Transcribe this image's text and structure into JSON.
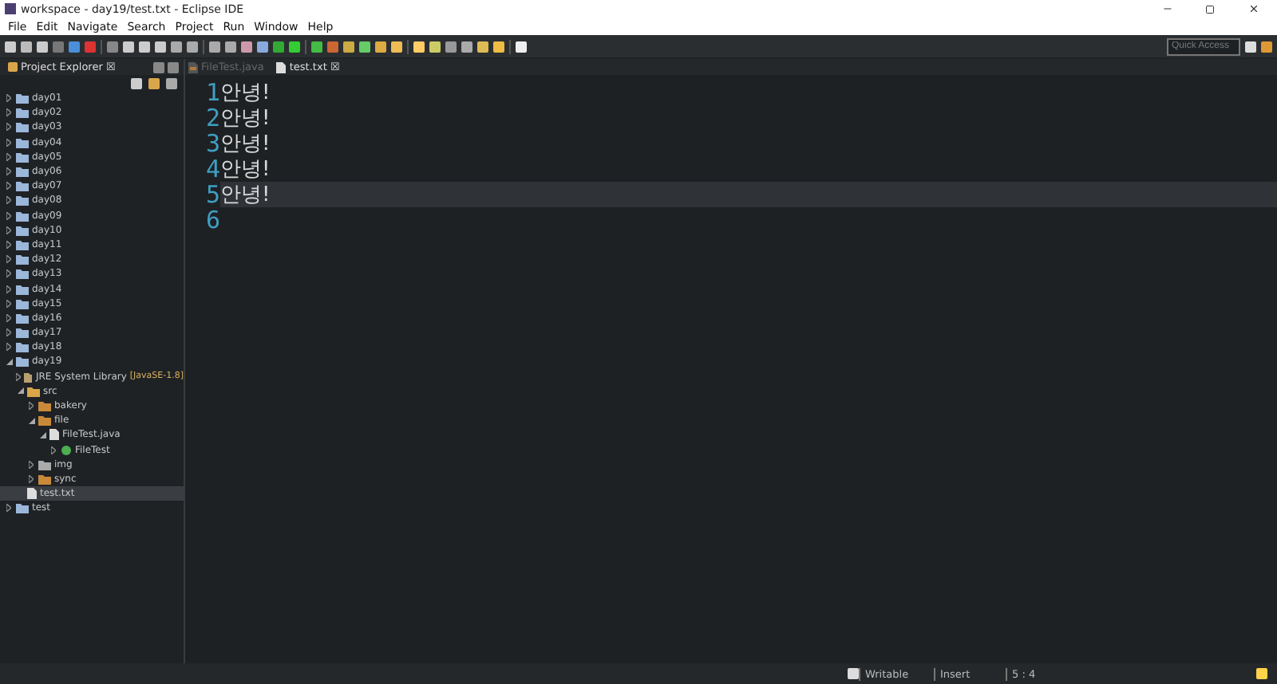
{
  "window": {
    "title": "workspace - day19/test.txt - Eclipse IDE"
  },
  "menu": [
    "File",
    "Edit",
    "Navigate",
    "Search",
    "Project",
    "Run",
    "Window",
    "Help"
  ],
  "quick_access": {
    "placeholder": "Quick Access"
  },
  "explorer": {
    "title": "Project Explorer",
    "close": "☒",
    "items": [
      {
        "label": "day01",
        "kind": "project",
        "expanded": false,
        "selected": false
      },
      {
        "label": "day02",
        "kind": "project",
        "expanded": false,
        "selected": false
      },
      {
        "label": "day03",
        "kind": "project",
        "expanded": false,
        "selected": false
      },
      {
        "label": "day04",
        "kind": "project",
        "expanded": false,
        "selected": false
      },
      {
        "label": "day05",
        "kind": "project",
        "expanded": false,
        "selected": false
      },
      {
        "label": "day06",
        "kind": "project",
        "expanded": false,
        "selected": false
      },
      {
        "label": "day07",
        "kind": "project",
        "expanded": false,
        "selected": false
      },
      {
        "label": "day08",
        "kind": "project",
        "expanded": false,
        "selected": false
      },
      {
        "label": "day09",
        "kind": "project",
        "expanded": false,
        "selected": false
      },
      {
        "label": "day10",
        "kind": "project",
        "expanded": false,
        "selected": false
      },
      {
        "label": "day11",
        "kind": "project",
        "expanded": false,
        "selected": false
      },
      {
        "label": "day12",
        "kind": "project",
        "expanded": false,
        "selected": false
      },
      {
        "label": "day13",
        "kind": "project",
        "expanded": false,
        "selected": false
      },
      {
        "label": "day14",
        "kind": "project",
        "expanded": false,
        "selected": false
      },
      {
        "label": "day15",
        "kind": "project",
        "expanded": false,
        "selected": false
      },
      {
        "label": "day16",
        "kind": "project",
        "expanded": false,
        "selected": false
      },
      {
        "label": "day17",
        "kind": "project",
        "expanded": false,
        "selected": false
      },
      {
        "label": "day18",
        "kind": "project",
        "expanded": false,
        "selected": false
      },
      {
        "label": "day19",
        "kind": "project",
        "expanded": true,
        "selected": false,
        "children": [
          {
            "label": "JRE System Library",
            "decoration": "[JavaSE-1.8]",
            "kind": "library",
            "expanded": false,
            "selected": false
          },
          {
            "label": "src",
            "kind": "source",
            "expanded": true,
            "selected": false,
            "children": [
              {
                "label": "bakery",
                "kind": "package",
                "expanded": false,
                "selected": false
              },
              {
                "label": "file",
                "kind": "package",
                "expanded": true,
                "selected": false,
                "children": [
                  {
                    "label": "FileTest.java",
                    "kind": "java",
                    "expanded": true,
                    "selected": false,
                    "children": [
                      {
                        "label": "FileTest",
                        "kind": "class",
                        "expanded": false,
                        "selected": false
                      }
                    ]
                  }
                ]
              },
              {
                "label": "img",
                "kind": "package-empty",
                "expanded": false,
                "selected": false
              },
              {
                "label": "sync",
                "kind": "package",
                "expanded": false,
                "selected": false
              }
            ]
          },
          {
            "label": "test.txt",
            "kind": "text",
            "selected": true
          }
        ]
      },
      {
        "label": "test",
        "kind": "project",
        "expanded": false,
        "selected": false
      }
    ]
  },
  "editor_tabs": [
    {
      "label": "FileTest.java",
      "kind": "java",
      "selected": false
    },
    {
      "label": "test.txt",
      "kind": "text",
      "selected": true,
      "close": "☒"
    }
  ],
  "editor": {
    "lines": [
      {
        "number": "1",
        "text": "안녕!",
        "current": false
      },
      {
        "number": "2",
        "text": "안녕!",
        "current": false
      },
      {
        "number": "3",
        "text": "안녕!",
        "current": false
      },
      {
        "number": "4",
        "text": "안녕!",
        "current": false
      },
      {
        "number": "5",
        "text": "안녕!",
        "current": true
      },
      {
        "number": "6",
        "current": false
      }
    ]
  },
  "status_bar": {
    "mode": "Writable",
    "insert": "Insert",
    "position": "5 : 4"
  }
}
